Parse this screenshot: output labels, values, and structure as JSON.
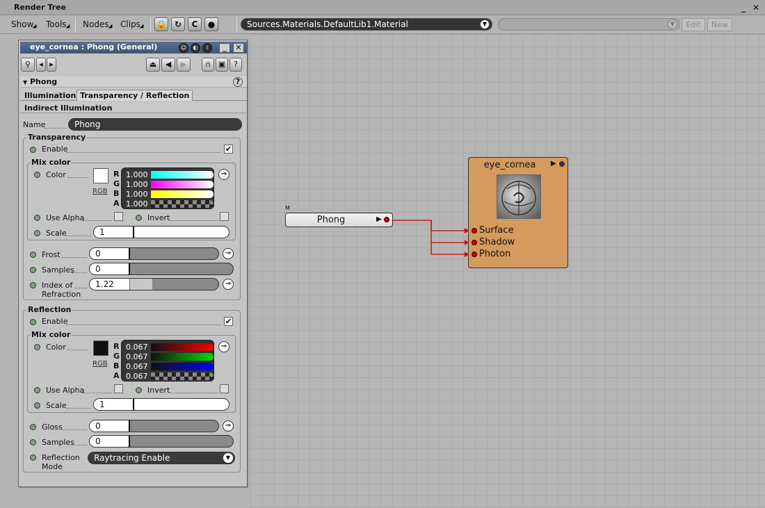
{
  "window": {
    "title": "Render Tree"
  },
  "toolbar": {
    "menus": [
      "Show",
      "Tools",
      "Nodes",
      "Clips"
    ],
    "icons": [
      "lock-icon",
      "refresh-icon",
      "c-icon",
      "apple-icon"
    ],
    "icon_glyphs": [
      "🔒",
      "↻",
      "C",
      "●"
    ],
    "path_value": "Sources.Materials.DefaultLib1.Material",
    "secondary_combo_value": "",
    "edit_label": "Edit",
    "new_label": "New"
  },
  "panel": {
    "title": "eye_cornea : Phong (General)",
    "header_icons": [
      "magnifier-icon",
      "arrow-left-icon",
      "arrow-right-icon",
      "home-icon",
      "back-icon",
      "forward-icon",
      "magnet-icon",
      "save-preset-icon",
      "help-icon"
    ],
    "section": "Phong",
    "tabs": [
      "Illumination",
      "Transparency / Reflection"
    ],
    "tab2": "Indirect Illumination",
    "name_label": "Name",
    "name_value": "Phong",
    "transparency": {
      "title": "Transparency",
      "enable_label": "Enable",
      "enabled": true,
      "mix_color_title": "Mix color",
      "color_label": "Color",
      "rgb_label": "RGB",
      "channels": [
        {
          "letter": "R",
          "value": "1.000",
          "color": "#00ffff"
        },
        {
          "letter": "G",
          "value": "1.000",
          "color": "#ff00ff"
        },
        {
          "letter": "B",
          "value": "1.000",
          "color": "#ffff00"
        },
        {
          "letter": "A",
          "value": "1.000",
          "color": "checker"
        }
      ],
      "swatch_color": "#ffffff",
      "use_alpha_label": "Use Alpha",
      "invert_label": "Invert",
      "scale_label": "Scale",
      "scale_value": "1",
      "frost_label": "Frost",
      "frost_value": "0",
      "samples_label": "Samples",
      "samples_value": "0",
      "ior_label": "Index of",
      "ior_label2": "Refraction",
      "ior_value": "1.22"
    },
    "reflection": {
      "title": "Reflection",
      "enable_label": "Enable",
      "enabled": true,
      "mix_color_title": "Mix color",
      "color_label": "Color",
      "rgb_label": "RGB",
      "channels": [
        {
          "letter": "R",
          "value": "0.067",
          "color": "#ff0000"
        },
        {
          "letter": "G",
          "value": "0.067",
          "color": "#00dd00"
        },
        {
          "letter": "B",
          "value": "0.067",
          "color": "#0000ff"
        },
        {
          "letter": "A",
          "value": "0.067",
          "color": "checker"
        }
      ],
      "swatch_color": "#111111",
      "use_alpha_label": "Use Alpha",
      "invert_label": "Invert",
      "scale_label": "Scale",
      "scale_value": "1",
      "gloss_label": "Gloss",
      "gloss_value": "0",
      "samples_label": "Samples",
      "samples_value": "0",
      "mode_label": "Reflection",
      "mode_label2": "Mode",
      "mode_value": "Raytracing Enable"
    }
  },
  "graph": {
    "phong_node": {
      "tag": "M",
      "label": "Phong"
    },
    "material_node": {
      "label": "eye_cornea",
      "ports": [
        "Surface",
        "Shadow",
        "Photon"
      ]
    }
  }
}
